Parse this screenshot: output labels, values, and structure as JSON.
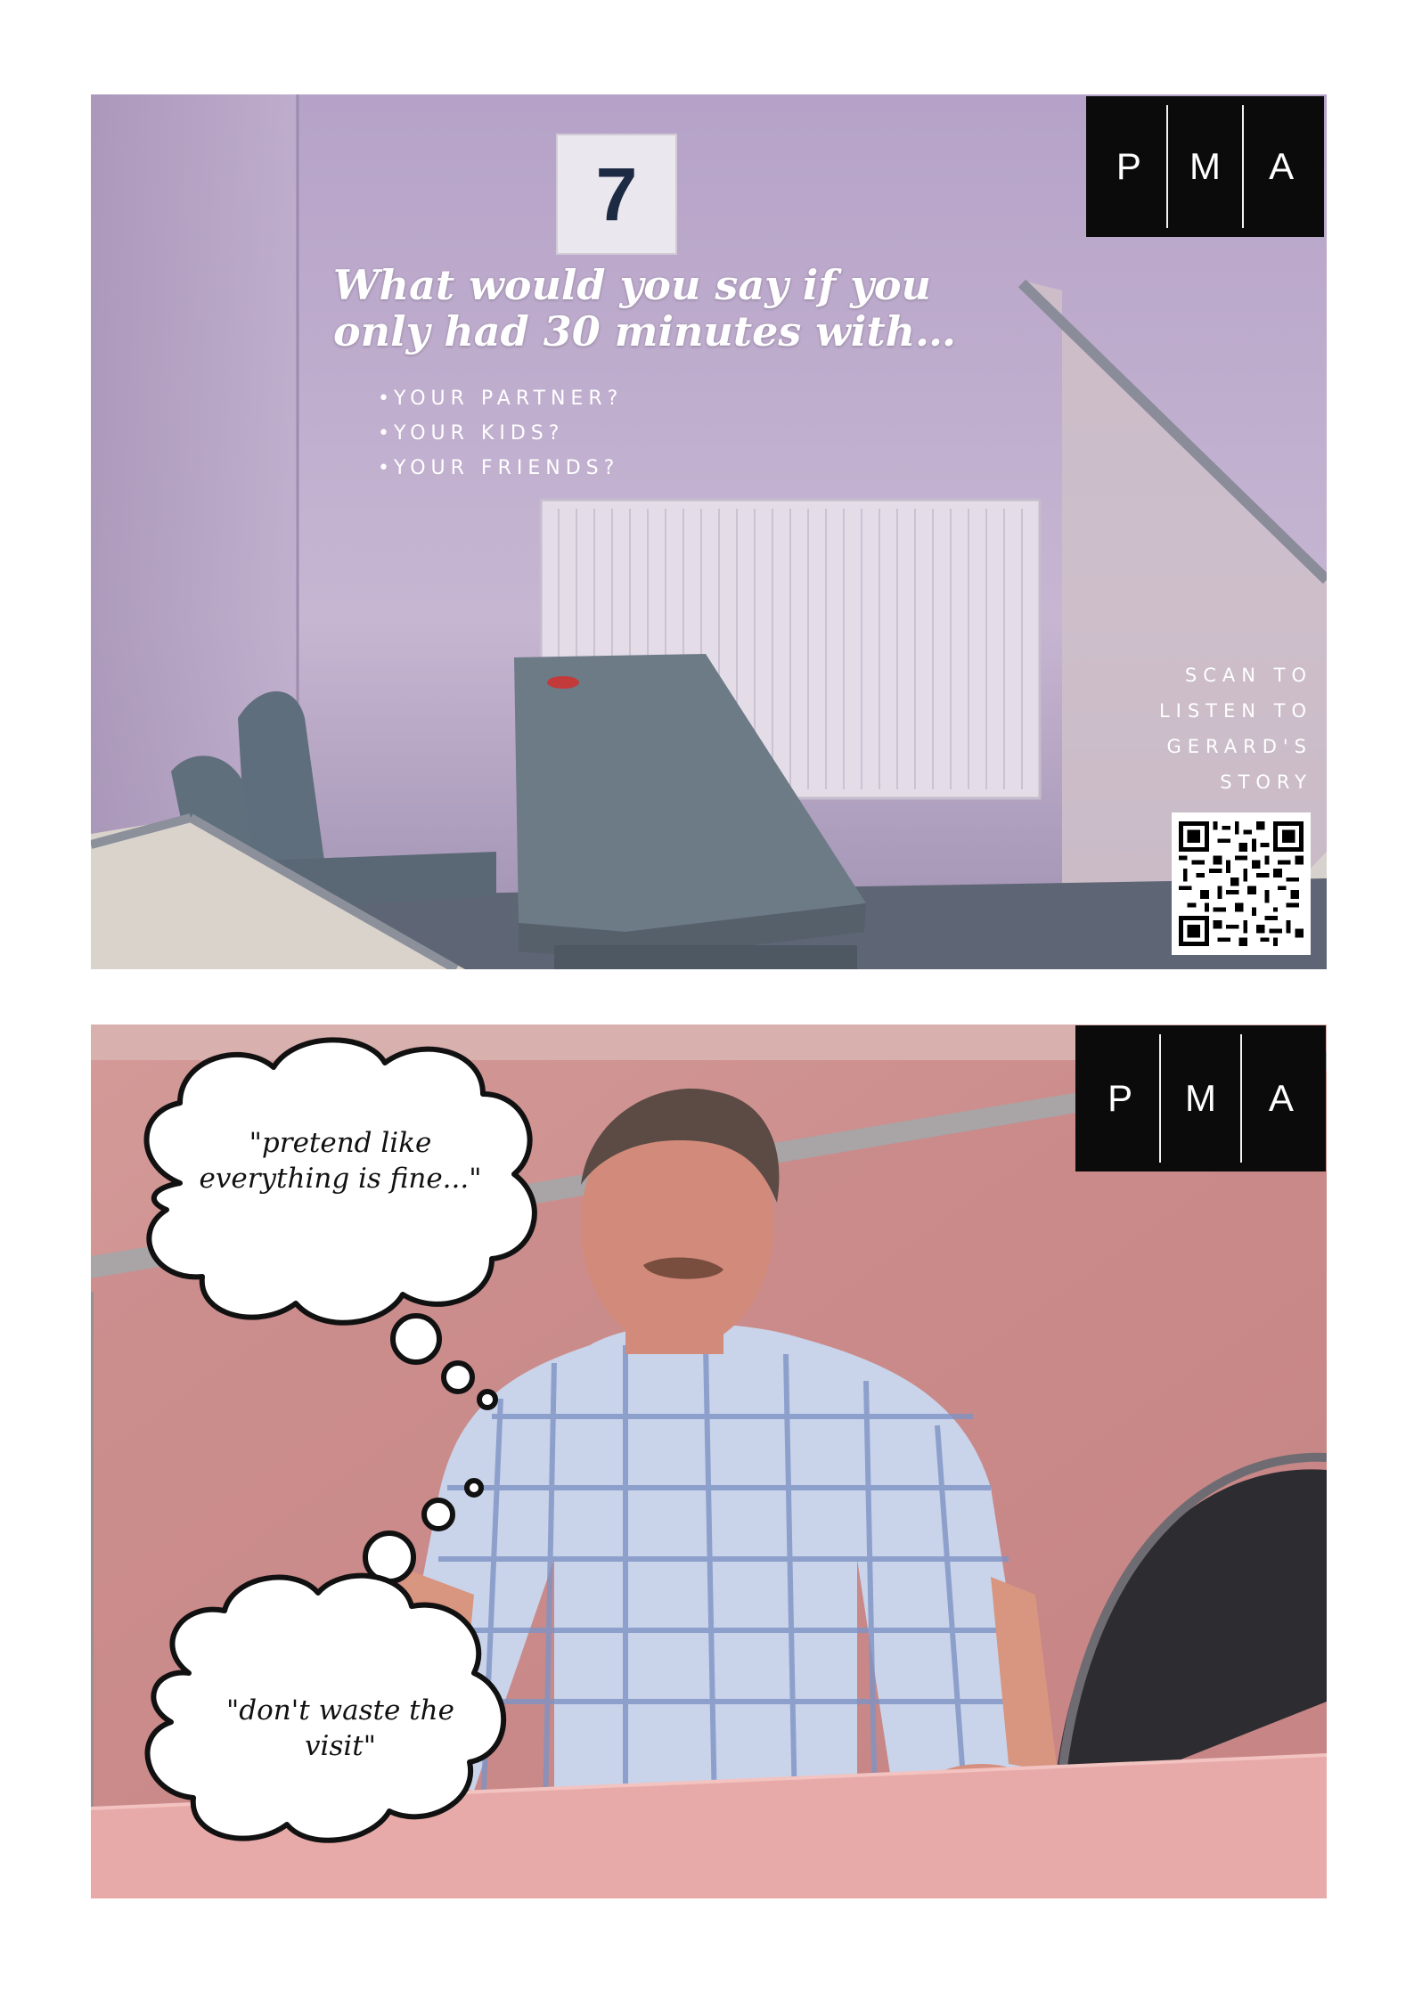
{
  "top_panel": {
    "room_number": "7",
    "headline_line1": "What would you say if you",
    "headline_line2": "only had 30 minutes with…",
    "bullets": [
      "YOUR PARTNER?",
      "YOUR KIDS?",
      "YOUR FRIENDS?"
    ],
    "scan_lines": [
      "SCAN TO",
      "LISTEN TO",
      "GERARD'S",
      "STORY"
    ],
    "logo_letters": [
      "P",
      "M",
      "A"
    ]
  },
  "bottom_panel": {
    "bubble1_line1": "\"pretend like",
    "bubble1_line2": "everything is fine...\"",
    "bubble2_line1": "\"don't waste the",
    "bubble2_line2": "visit\"",
    "logo_letters": [
      "P",
      "M",
      "A"
    ]
  },
  "colors": {
    "top_wall": "#b9a6c8",
    "top_floor": "#6b7382",
    "table_grey": "#6c7a86",
    "bottom_wall": "#c98a88",
    "table_pink": "#e8aaa8",
    "shirt": "#c7d3ea",
    "logo_bg": "#0b0b0b"
  }
}
